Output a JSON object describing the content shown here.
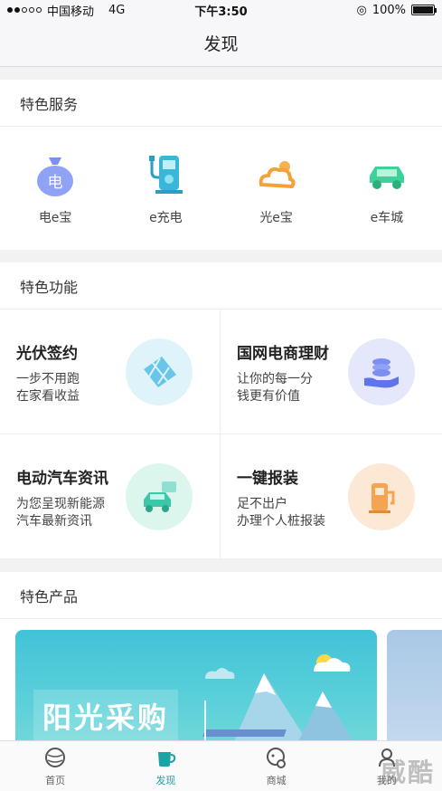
{
  "status_bar": {
    "carrier": "中国移动",
    "network": "4G",
    "time": "下午3:50",
    "battery": "100%"
  },
  "nav": {
    "title": "发现"
  },
  "services_section": {
    "title": "特色服务",
    "items": [
      {
        "label": "电e宝",
        "icon": "money-bag-icon"
      },
      {
        "label": "e充电",
        "icon": "charging-station-icon"
      },
      {
        "label": "光e宝",
        "icon": "sun-cloud-icon"
      },
      {
        "label": "e车城",
        "icon": "car-icon"
      }
    ]
  },
  "features_section": {
    "title": "特色功能",
    "items": [
      {
        "title": "光伏签约",
        "desc": "一步不用跑\n在家看收益",
        "icon": "solar-panel-icon"
      },
      {
        "title": "国网电商理财",
        "desc": "让你的每一分\n钱更有价值",
        "icon": "coins-hand-icon"
      },
      {
        "title": "电动汽车资讯",
        "desc": "为您呈现新能源\n汽车最新资讯",
        "icon": "car-news-icon"
      },
      {
        "title": "一键报装",
        "desc": "足不出户\n办理个人桩报装",
        "icon": "charging-pile-icon"
      }
    ]
  },
  "products_section": {
    "title": "特色产品",
    "banner_text": "阳光采购"
  },
  "tab_bar": {
    "tabs": [
      {
        "label": "首页",
        "icon": "globe-icon"
      },
      {
        "label": "发现",
        "icon": "cup-icon"
      },
      {
        "label": "商城",
        "icon": "shop-icon"
      },
      {
        "label": "我的",
        "icon": "user-icon"
      }
    ],
    "active": "发现"
  },
  "watermark": "威酷",
  "colors": {
    "accent": "#1aa5a5",
    "background": "#f2f2f5"
  }
}
